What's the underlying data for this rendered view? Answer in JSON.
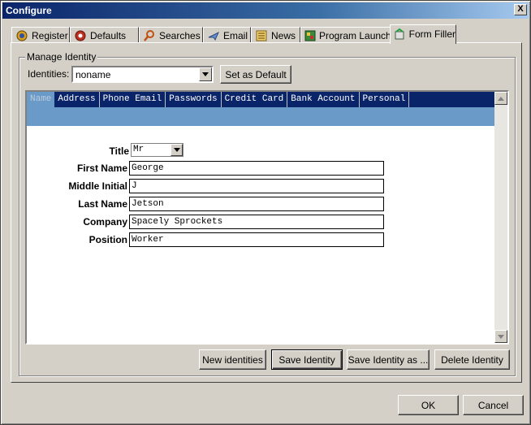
{
  "window": {
    "title": "Configure",
    "close_symbol": "X"
  },
  "tabs": [
    {
      "label": "Register",
      "icon": "register-icon"
    },
    {
      "label": "Defaults",
      "icon": "defaults-icon"
    },
    {
      "label": "Searches",
      "icon": "searches-icon"
    },
    {
      "label": "Email",
      "icon": "email-icon"
    },
    {
      "label": "News",
      "icon": "news-icon"
    },
    {
      "label": "Program Launcher",
      "icon": "program-launcher-icon"
    },
    {
      "label": "Form Filler",
      "icon": "form-filler-icon",
      "active": true
    }
  ],
  "manage": {
    "group_label": "Manage Identity",
    "identities_label": "Identities:",
    "identities_value": "noname",
    "set_default_label": "Set as Default"
  },
  "subtabs": [
    "Name",
    "Address",
    "Phone Email",
    "Passwords",
    "Credit  Card",
    "Bank Account",
    "Personal"
  ],
  "form": {
    "title_label": "Title",
    "title_value": "Mr",
    "first_label": "First Name",
    "first_value": "George",
    "middle_label": "Middle Initial",
    "middle_value": "J",
    "last_label": "Last Name",
    "last_value": "Jetson",
    "company_label": "Company",
    "company_value": "Spacely Sprockets",
    "position_label": "Position",
    "position_value": "Worker"
  },
  "actions": {
    "new": "New identities",
    "save": "Save Identity",
    "save_as": "Save Identity as ...",
    "delete": "Delete Identity"
  },
  "dialog": {
    "ok": "OK",
    "cancel": "Cancel"
  },
  "colors": {
    "title_gradient_start": "#0a246a",
    "subtab_bar": "#0a246a",
    "active_subtab": "#6a9ac8",
    "face": "#d4d0c8"
  }
}
